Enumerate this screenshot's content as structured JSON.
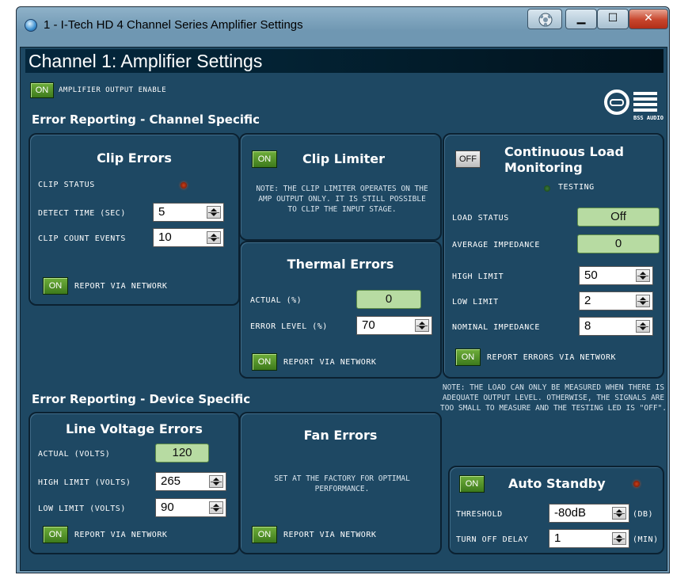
{
  "window": {
    "title": "1 - I-Tech HD 4 Channel Series Amplifier Settings",
    "accent_color": "#1e4863",
    "header_color": "#032233"
  },
  "header": {
    "title": "Channel 1: Amplifier Settings"
  },
  "amp_output": {
    "button": "ON",
    "label": "AMPLIFIER OUTPUT ENABLE"
  },
  "logo": {
    "text": "BSS AUDIO"
  },
  "sections": {
    "channel": "Error Reporting - Channel Specific",
    "device": "Error Reporting - Device Specific"
  },
  "clip_errors": {
    "title": "Clip Errors",
    "clip_status_label": "CLIP STATUS",
    "detect_time_label": "DETECT TIME (SEC)",
    "detect_time_value": "5",
    "clip_count_label": "CLIP COUNT EVENTS",
    "clip_count_value": "10",
    "report_button": "ON",
    "report_label": "REPORT VIA NETWORK"
  },
  "clip_limiter": {
    "button": "ON",
    "title": "Clip Limiter",
    "note": "NOTE: THE CLIP LIMITER OPERATES ON THE AMP OUTPUT ONLY. IT IS STILL POSSIBLE TO CLIP THE INPUT STAGE."
  },
  "thermal_errors": {
    "title": "Thermal Errors",
    "actual_label": "ACTUAL (%)",
    "actual_value": "0",
    "error_level_label": "ERROR LEVEL (%)",
    "error_level_value": "70",
    "report_button": "ON",
    "report_label": "REPORT VIA NETWORK"
  },
  "load_monitoring": {
    "button": "OFF",
    "title_line1": "Continuous Load",
    "title_line2": "Monitoring",
    "testing_label": "TESTING",
    "load_status_label": "LOAD STATUS",
    "load_status_value": "Off",
    "avg_impedance_label": "AVERAGE IMPEDANCE",
    "avg_impedance_value": "0",
    "high_limit_label": "HIGH LIMIT",
    "high_limit_value": "50",
    "low_limit_label": "LOW LIMIT",
    "low_limit_value": "2",
    "nominal_label": "NOMINAL IMPEDANCE",
    "nominal_value": "8",
    "report_button": "ON",
    "report_label": "REPORT ERRORS VIA NETWORK"
  },
  "load_note": "NOTE: THE LOAD CAN ONLY BE MEASURED WHEN THERE IS ADEQUATE OUTPUT LEVEL. OTHERWISE, THE SIGNALS ARE TOO SMALL TO MEASURE AND THE TESTING LED IS \"OFF\".",
  "line_voltage": {
    "title": "Line Voltage Errors",
    "actual_label": "ACTUAL (VOLTS)",
    "actual_value": "120",
    "high_label": "HIGH LIMIT (VOLTS)",
    "high_value": "265",
    "low_label": "LOW LIMIT (VOLTS)",
    "low_value": "90",
    "report_button": "ON",
    "report_label": "REPORT VIA NETWORK"
  },
  "fan_errors": {
    "title": "Fan Errors",
    "note": "SET AT THE FACTORY FOR OPTIMAL PERFORMANCE.",
    "report_button": "ON",
    "report_label": "REPORT VIA NETWORK"
  },
  "auto_standby": {
    "button": "ON",
    "title": "Auto Standby",
    "threshold_label": "THRESHOLD",
    "threshold_value": "-80dB",
    "threshold_unit": "(dB)",
    "delay_label": "TURN OFF DELAY",
    "delay_value": "1",
    "delay_unit": "(MIN)"
  }
}
